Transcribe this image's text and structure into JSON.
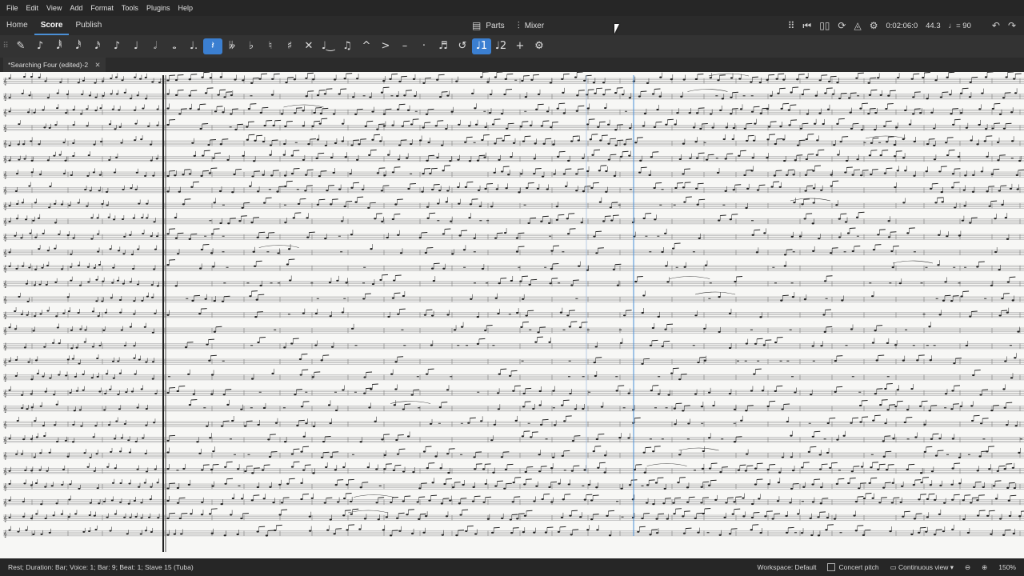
{
  "menu": [
    "File",
    "Edit",
    "View",
    "Add",
    "Format",
    "Tools",
    "Plugins",
    "Help"
  ],
  "workspace_tabs": [
    {
      "label": "Home",
      "active": false
    },
    {
      "label": "Score",
      "active": true
    },
    {
      "label": "Publish",
      "active": false
    }
  ],
  "center_tabs": {
    "parts": "Parts",
    "mixer": "Mixer"
  },
  "playback": {
    "time": "0:02:06:0",
    "position": "44.3",
    "tempo": "♩= 90"
  },
  "note_toolbar": {
    "items": [
      {
        "name": "grip-handle",
        "glyph": "⠿"
      },
      {
        "name": "pencil-input-icon",
        "glyph": "✎"
      },
      {
        "name": "note-input-mode-icon",
        "glyph": "♪"
      },
      {
        "name": "duration-64th-icon",
        "glyph": "𝅘𝅥𝅱"
      },
      {
        "name": "duration-32nd-icon",
        "glyph": "𝅘𝅥𝅰"
      },
      {
        "name": "duration-16th-icon",
        "glyph": "𝅘𝅥𝅯"
      },
      {
        "name": "duration-eighth-icon",
        "glyph": "♪"
      },
      {
        "name": "duration-quarter-icon",
        "glyph": "♩"
      },
      {
        "name": "duration-half-icon",
        "glyph": "𝅗𝅥"
      },
      {
        "name": "duration-whole-icon",
        "glyph": "𝅝"
      },
      {
        "name": "augmentation-dot-icon",
        "glyph": "♩."
      },
      {
        "name": "rest-icon",
        "glyph": "𝄽",
        "selected": true
      },
      {
        "name": "double-flat-icon",
        "glyph": "𝄫"
      },
      {
        "name": "flat-icon",
        "glyph": "♭"
      },
      {
        "name": "natural-icon",
        "glyph": "♮"
      },
      {
        "name": "sharp-icon",
        "glyph": "♯"
      },
      {
        "name": "double-sharp-icon",
        "glyph": "✕"
      },
      {
        "name": "tie-icon",
        "glyph": "♩‿"
      },
      {
        "name": "slur-icon",
        "glyph": "♫"
      },
      {
        "name": "marcato-icon",
        "glyph": "^"
      },
      {
        "name": "accent-icon",
        "glyph": ">"
      },
      {
        "name": "tenuto-icon",
        "glyph": "–"
      },
      {
        "name": "staccato-icon",
        "glyph": "·"
      },
      {
        "name": "tuplet-icon",
        "glyph": "♬"
      },
      {
        "name": "flip-direction-icon",
        "glyph": "↺"
      },
      {
        "name": "voice-1-icon",
        "glyph": "♩1",
        "selected": true
      },
      {
        "name": "voice-2-icon",
        "glyph": "♩2"
      },
      {
        "name": "add-icon",
        "glyph": "+"
      },
      {
        "name": "customize-toolbar-icon",
        "glyph": "⚙"
      }
    ]
  },
  "document_tab": {
    "title": "*Searching Four (edited)-2",
    "close": "✕"
  },
  "status": {
    "selection": "Rest; Duration: Bar; Voice: 1; Bar: 9; Beat: 1; Stave 15 (Tuba)",
    "workspace": "Workspace: Default",
    "concert_pitch": "Concert pitch",
    "view_mode": "Continuous view",
    "zoom": "150%"
  },
  "colors": {
    "accent": "#3b7fd1",
    "paper": "#f7f7f5",
    "chrome": "#2b2b2b"
  }
}
